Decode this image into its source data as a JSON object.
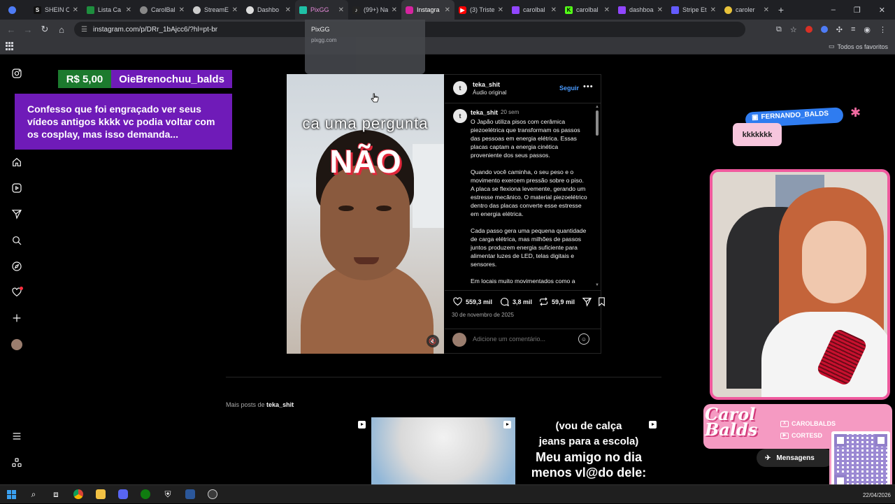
{
  "browser": {
    "tabs": [
      {
        "label": "",
        "favicon": "gemini-icon",
        "color": "#4e7cf6",
        "state": "normal"
      },
      {
        "label": "SHEIN C",
        "favicon": "shein-icon",
        "color": "#111111",
        "glyph": "S",
        "state": "normal"
      },
      {
        "label": "Lista Ca",
        "favicon": "sheets-icon",
        "color": "#1e8e3e",
        "state": "normal"
      },
      {
        "label": "CarolBal",
        "favicon": "globe-icon",
        "color": "#888888",
        "state": "normal"
      },
      {
        "label": "StreamE",
        "favicon": "streamelements-icon",
        "color": "#cccccc",
        "state": "normal"
      },
      {
        "label": "Dashbo",
        "favicon": "globe-icon",
        "color": "#dddddd",
        "state": "normal"
      },
      {
        "label": "PixGG",
        "favicon": "pixgg-icon",
        "color": "#1fc1a7",
        "state": "hovered"
      },
      {
        "label": "(99+) Na",
        "favicon": "tiktok-icon",
        "color": "#222222",
        "state": "normal"
      },
      {
        "label": "Instagra",
        "favicon": "instagram-icon",
        "color": "#d6249f",
        "state": "active"
      },
      {
        "label": "(3) Triste",
        "favicon": "youtube-icon",
        "color": "#ff0000",
        "state": "normal"
      },
      {
        "label": "carolbal",
        "favicon": "twitch-icon",
        "color": "#9146ff",
        "state": "normal"
      },
      {
        "label": "carolbal",
        "favicon": "kick-icon",
        "color": "#53fc18",
        "glyph": "K",
        "state": "normal"
      },
      {
        "label": "dashboa",
        "favicon": "twitch-icon",
        "color": "#9146ff",
        "state": "normal"
      },
      {
        "label": "Stripe Et",
        "favicon": "stripe-icon",
        "color": "#635bff",
        "state": "normal"
      },
      {
        "label": "caroler",
        "favicon": "chrome-ext-icon",
        "color": "#e8c23a",
        "state": "normal"
      }
    ],
    "new_tab": "+",
    "window_controls": {
      "minimize": "–",
      "maximize": "❐",
      "close": "✕"
    },
    "url": "instagram.com/p/DRr_1bAjcc6/?hl=pt-br",
    "bookmarks_folder": "Todos os favoritos",
    "hover_card": {
      "title": "PixGG",
      "url": "pixgg.com"
    }
  },
  "donation": {
    "amount": "R$ 5,00",
    "name": "OieBrenochuu_balds",
    "message": "Confesso que foi engraçado ver seus vídeos antigos kkkk vc podia voltar com os cosplay, mas isso demanda..."
  },
  "sidebar": {
    "items": [
      "instagram-icon",
      "home-icon",
      "reels-icon",
      "direct-icon",
      "search-icon",
      "explore-icon",
      "notifications-icon",
      "create-icon",
      "profile-avatar",
      "menu-icon",
      "threads-icon"
    ]
  },
  "post": {
    "video_caption": "ca uma pergunta",
    "video_big_text": "NÃO",
    "username": "teka_shit",
    "audio": "Áudio original",
    "follow_label": "Seguir",
    "more_label": "•••",
    "caption_time": "20 sem",
    "caption_text": "O Japão utiliza pisos com cerâmica piezoelétrica que transformam os passos das pessoas em energia elétrica. Essas placas captam a energia cinética proveniente dos seus passos.\n\nQuando você caminha, o seu peso e o movimento exercem pressão sobre o piso. A placa se flexiona levemente, gerando um estresse mecânico. O material piezoelétrico dentro das placas converte esse estresse em energia elétrica.\n\nCada passo gera uma pequena quantidade de carga elétrica, mas milhões de passos juntos produzem energia suficiente para alimentar luzes de LED, telas digitais e sensores.\n\nEm locais muito movimentados como a",
    "likes": "559,3 mil",
    "comments": "3,8 mil",
    "reposts": "59,9 mil",
    "date": "30 de novembro de 2025",
    "comment_placeholder": "Adicione um comentário..."
  },
  "more_posts": {
    "prefix": "Mais posts de",
    "user": "teka_shit",
    "thumb3_line1": "(vou de calça",
    "thumb3_line2": "jeans para a escola)",
    "thumb3_line3": "Meu amigo no dia",
    "thumb3_line4": "menos vl@do dele:"
  },
  "chat": {
    "user": "FERNANDO_BALDS",
    "message": "kkkkkkk"
  },
  "branding": {
    "logo_text": "Carol Balds",
    "social1": "CAROLBALDS",
    "social2": "CORTESD",
    "messages_label": "Mensagens"
  },
  "taskbar": {
    "date": "22/04/2026"
  },
  "colors": {
    "donation_amount_bg": "#1c7a2e",
    "donation_bg": "#6f1bb8",
    "instagram_follow": "#4a9bff",
    "cam_border": "#f05a9e",
    "chat_name_bg": "#2f7cf0"
  }
}
